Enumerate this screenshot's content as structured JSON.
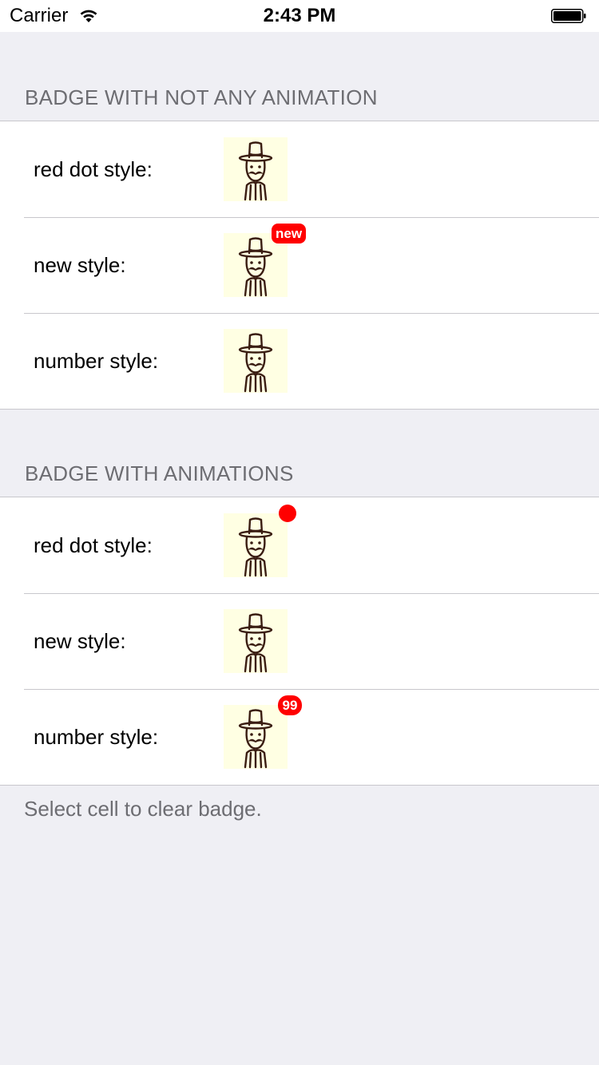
{
  "status_bar": {
    "carrier": "Carrier",
    "time": "2:43 PM"
  },
  "sections": [
    {
      "header": "BADGE WITH NOT ANY ANIMATION",
      "rows": [
        {
          "label": "red dot style:",
          "badge_type": "none"
        },
        {
          "label": "new style:",
          "badge_type": "new",
          "badge_text": "new"
        },
        {
          "label": "number style:",
          "badge_type": "none"
        }
      ]
    },
    {
      "header": "BADGE WITH ANIMATIONS",
      "rows": [
        {
          "label": "red dot style:",
          "badge_type": "dot"
        },
        {
          "label": "new style:",
          "badge_type": "none"
        },
        {
          "label": "number style:",
          "badge_type": "number",
          "badge_text": "99"
        }
      ]
    }
  ],
  "footer": "Select cell to clear badge.",
  "icons": {
    "avatar": "gentleman-top-hat-icon",
    "wifi": "wifi-icon",
    "battery": "battery-icon"
  },
  "colors": {
    "badge": "#ff0000",
    "avatar_bg": "#ffffe3",
    "background": "#efeff4",
    "header_text": "#6d6d72"
  }
}
